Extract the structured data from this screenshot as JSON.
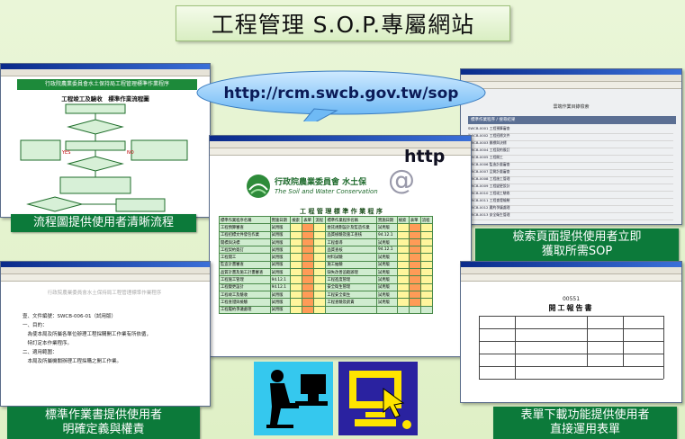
{
  "title": "工程管理 S.O.P.專屬網站",
  "url": "http://rcm.swcb.gov.tw/sop",
  "captions": {
    "flowchart": "流程圖提供使用者清晰流程",
    "search": [
      "檢索頁面提供使用者立即",
      "獲取所需SOP"
    ],
    "manual": [
      "標準作業書提供使用者",
      "明確定義與權責"
    ],
    "forms": [
      "表單下載功能提供使用者",
      "直接運用表單"
    ]
  },
  "flowchart_window": {
    "header": "行政院農業委員會水土保持局工程管理標準作業程序",
    "chart_title": "工程竣工及驗收　標準作業流程圖",
    "labels": {
      "yes": "YES",
      "no": "NO"
    }
  },
  "center_window": {
    "logo_text_zh": "行政院農業委員會 水土保",
    "logo_text_en": "The Soil and Water Conservation",
    "http": "http",
    "banner": "工 程 管 理 標 準 作 業 程 序",
    "col_headers": [
      "標準作業程序名稱",
      "實施日期",
      "檢索",
      "表單",
      "流程"
    ],
    "left_items": [
      "工程預算審查",
      "工程招標文件發包作業",
      "開標與決標",
      "工程契約簽訂",
      "工程開工",
      "監造計畫審查",
      "品質計畫及施工計畫審查",
      "工程施工管理",
      "工程變更設計",
      "工程竣工及驗收",
      "工程查證與檢驗",
      "工程履約爭議處理"
    ],
    "right_items": [
      "委託規劃設計及監造作業",
      "品質檢驗及施工查核",
      "工程督導",
      "品質查核",
      "材料試驗",
      "施工抽驗",
      "缺失改善追蹤辦理",
      "工程進度管理",
      "安全衛生管理",
      "工程安全衛生",
      "工程查驗及罰責"
    ],
    "dates": [
      "試用版",
      "試用版",
      "試用版",
      "試用版",
      "試用版",
      "試用版",
      "試用版",
      "94.12.1",
      "94.12.1",
      "試用版",
      "試用版",
      "試用版"
    ],
    "dates_right": [
      "試用版",
      "94.12.1",
      "試用版",
      "94.12.1",
      "試用版",
      "試用版",
      "試用版",
      "試用版",
      "試用版",
      "試用版",
      "試用版"
    ]
  },
  "search_window": {
    "title": "雲端作業目錄檢索",
    "result_heading": "標準作業程序 / 搜尋結果",
    "rows": [
      "SWCB-0001 工程預算審查",
      "SWCB-0002 工程招標文件",
      "SWCB-0003 開標與決標",
      "SWCB-0004 工程契約簽訂",
      "SWCB-0005 工程開工",
      "SWCB-0006 監造計畫審查",
      "SWCB-0007 品質計畫審查",
      "SWCB-0008 工程施工管理",
      "SWCB-0009 工程變更設計",
      "SWCB-0010 工程竣工驗收",
      "SWCB-0011 工程查證檢驗",
      "SWCB-0012 履約爭議處理",
      "SWCB-0013 安全衛生管理"
    ]
  },
  "manual_window": {
    "header": "行政院農業委員會水土保持局工程管理標準作業程序",
    "lines": [
      "壹、文件編號：SWCB-006-01（試用版）",
      "一、目的：",
      "　為使本局及所屬各單位辦理工程採購開工作業有所依循，",
      "　特訂定本作業程序。",
      "二、適用範圍：",
      "　本局及所屬機關辦理工程採購之開工作業。"
    ]
  },
  "form_window": {
    "form_no": "00551",
    "form_title": "開工報告書"
  },
  "colors": {
    "caption_bg": "#0c7a3a",
    "bubble": "#7ec7ff",
    "title_bg": "#d9eec2"
  }
}
